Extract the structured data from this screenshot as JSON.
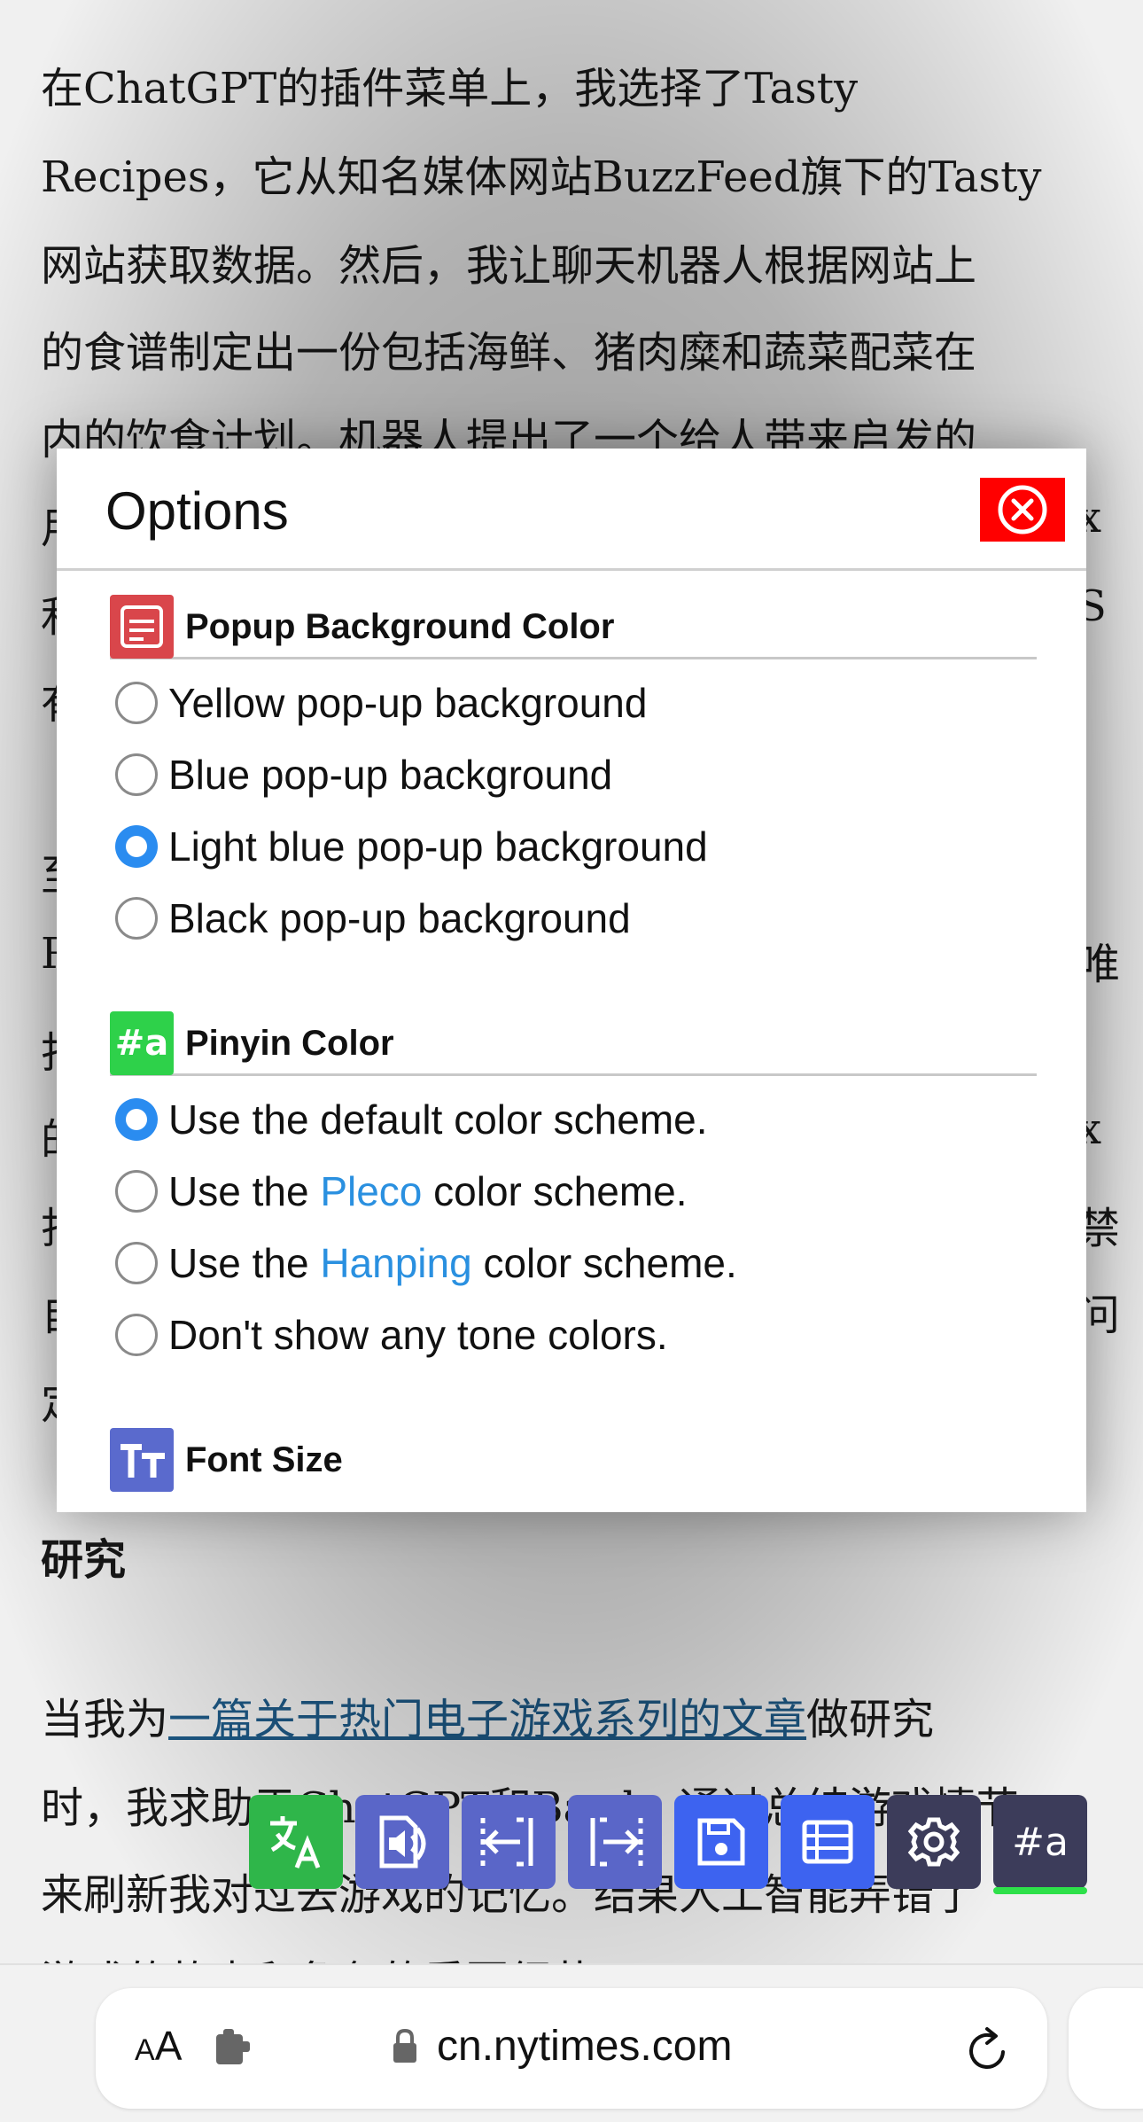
{
  "article": {
    "p1_lines": [
      "在ChatGPT的插件菜单上，我选择了Tasty",
      "Recipes，它从知名媒体网站BuzzFeed旗下的Tasty",
      "网站获取数据。然后，我让聊天机器人根据网站上",
      "的食谱制定出一份包括海鲜、猪肉糜和蔬菜配菜在",
      "内的饮食计划。机器人提出了一个给人带来启发的"
    ],
    "left_fragments": [
      "用",
      "利",
      "有",
      "至",
      "R",
      "打",
      "的",
      "打",
      "自",
      "定"
    ],
    "right_fragments": [
      "x",
      "S",
      "唯",
      "x",
      "禁",
      "问"
    ],
    "heading": "研究",
    "p2_before_link": "当我为",
    "p2_link": "一篇关于热门电子游戏系列的文章",
    "p2_after_link": "做研究",
    "p2_line2": "时，我求助于ChatGPT和Bard，通过总结游戏情节",
    "p2_line3": "来刷新我对过去游戏的记忆。结果人工智能弄错了",
    "p2_line4": "游戏的故事和角色的重要细节。"
  },
  "options_panel": {
    "title": "Options",
    "close_icon": "close-circle-icon",
    "sections": [
      {
        "label": "Popup Background Color",
        "icon": "popup-color-icon",
        "icon_color": "#d9464b",
        "options": [
          {
            "label": "Yellow pop-up background",
            "selected": false
          },
          {
            "label": "Blue pop-up background",
            "selected": false
          },
          {
            "label": "Light blue pop-up background",
            "selected": true
          },
          {
            "label": "Black pop-up background",
            "selected": false
          }
        ]
      },
      {
        "label": "Pinyin Color",
        "icon": "pinyin-icon",
        "icon_color": "#2ed14a",
        "options": [
          {
            "label": "Use the default color scheme.",
            "selected": true
          },
          {
            "prefix": "Use the ",
            "link": "Pleco",
            "suffix": " color scheme.",
            "selected": false
          },
          {
            "prefix": "Use the ",
            "link": "Hanping",
            "suffix": " color scheme.",
            "selected": false
          },
          {
            "label": "Don't show any tone colors.",
            "selected": false
          }
        ]
      },
      {
        "label": "Font Size",
        "icon": "font-size-icon",
        "icon_color": "#5a6acd"
      }
    ]
  },
  "toolbar": {
    "buttons": [
      {
        "name": "translate-icon",
        "color": "#2fb64a"
      },
      {
        "name": "speak-icon",
        "color": "#5a66c8"
      },
      {
        "name": "prev-icon",
        "color": "#5a66c8"
      },
      {
        "name": "next-icon",
        "color": "#5a66c8"
      },
      {
        "name": "save-icon",
        "color": "#3d63f0"
      },
      {
        "name": "list-icon",
        "color": "#3d63f0"
      },
      {
        "name": "settings-icon",
        "color": "#3c3c5a"
      },
      {
        "name": "pinyin-toggle-icon",
        "color": "#3c3c5a"
      }
    ],
    "pinyin_glyph": "#a"
  },
  "browser": {
    "aa_small": "A",
    "aa_big": "A",
    "url": "cn.nytimes.com"
  }
}
